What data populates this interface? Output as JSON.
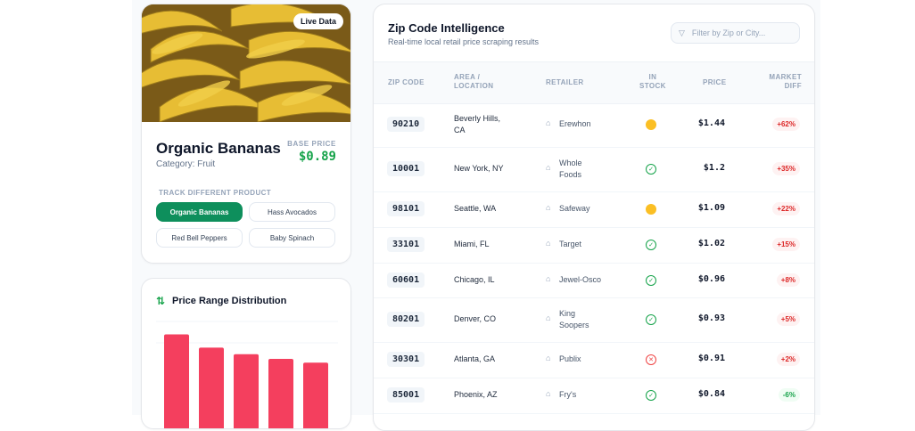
{
  "product": {
    "live_badge": "Live Data",
    "name": "Organic Bananas",
    "category": "Category: Fruit",
    "base_price_label": "BASE PRICE",
    "base_price": "$0.89",
    "track_label": "TRACK DIFFERENT PRODUCT",
    "options": [
      "Organic Bananas",
      "Hass Avocados",
      "Red Bell Peppers",
      "Baby Spinach"
    ],
    "selected_option": "Organic Bananas"
  },
  "chart": {
    "title": "Price Range Distribution",
    "bar_color": "#f43f5e"
  },
  "chart_data": {
    "type": "bar",
    "title": "Price Range Distribution",
    "categories": [
      "",
      "",
      "",
      "",
      ""
    ],
    "values": [
      92,
      78,
      71,
      66,
      62
    ],
    "xlabel": "",
    "ylabel": "",
    "ylim": [
      0,
      100
    ]
  },
  "table": {
    "title": "Zip Code Intelligence",
    "subtitle": "Real-time local retail price scraping results",
    "filter_placeholder": "Filter by Zip or City...",
    "headers": {
      "zip": "ZIP CODE",
      "area_line1": "AREA /",
      "area_line2": "LOCATION",
      "retailer": "RETAILER",
      "stock_line1": "IN",
      "stock_line2": "STOCK",
      "price": "PRICE",
      "diff_line1": "MARKET",
      "diff_line2": "DIFF"
    },
    "rows": [
      {
        "zip": "90210",
        "area1": "Beverly Hills,",
        "area2": "CA",
        "retailer1": "Erewhon",
        "retailer2": "",
        "stock": "low",
        "price": "$1.44",
        "diff": "+62%",
        "dir": "up"
      },
      {
        "zip": "10001",
        "area1": "New York, NY",
        "area2": "",
        "retailer1": "Whole",
        "retailer2": "Foods",
        "stock": "yes",
        "price": "$1.2",
        "diff": "+35%",
        "dir": "up"
      },
      {
        "zip": "98101",
        "area1": "Seattle, WA",
        "area2": "",
        "retailer1": "Safeway",
        "retailer2": "",
        "stock": "low",
        "price": "$1.09",
        "diff": "+22%",
        "dir": "up"
      },
      {
        "zip": "33101",
        "area1": "Miami, FL",
        "area2": "",
        "retailer1": "Target",
        "retailer2": "",
        "stock": "yes",
        "price": "$1.02",
        "diff": "+15%",
        "dir": "up"
      },
      {
        "zip": "60601",
        "area1": "Chicago, IL",
        "area2": "",
        "retailer1": "Jewel-Osco",
        "retailer2": "",
        "stock": "yes",
        "price": "$0.96",
        "diff": "+8%",
        "dir": "up"
      },
      {
        "zip": "80201",
        "area1": "Denver, CO",
        "area2": "",
        "retailer1": "King",
        "retailer2": "Soopers",
        "stock": "yes",
        "price": "$0.93",
        "diff": "+5%",
        "dir": "up"
      },
      {
        "zip": "30301",
        "area1": "Atlanta, GA",
        "area2": "",
        "retailer1": "Publix",
        "retailer2": "",
        "stock": "no",
        "price": "$0.91",
        "diff": "+2%",
        "dir": "up"
      },
      {
        "zip": "85001",
        "area1": "Phoenix, AZ",
        "area2": "",
        "retailer1": "Fry's",
        "retailer2": "",
        "stock": "yes",
        "price": "$0.84",
        "diff": "-6%",
        "dir": "down"
      }
    ]
  },
  "colors": {
    "accent": "#0e8f5c",
    "price_green": "#16a34a",
    "up": "#dc2626",
    "down": "#16a34a",
    "stock_low": "#fbbf24",
    "stock_no": "#ef4444"
  },
  "icons": {
    "filter": "filter-icon",
    "retailer": "basket-icon",
    "chart": "sort-arrows-icon",
    "in_stock": "check-circle-icon",
    "out_of_stock": "x-circle-icon",
    "low_stock": "dot-icon"
  }
}
